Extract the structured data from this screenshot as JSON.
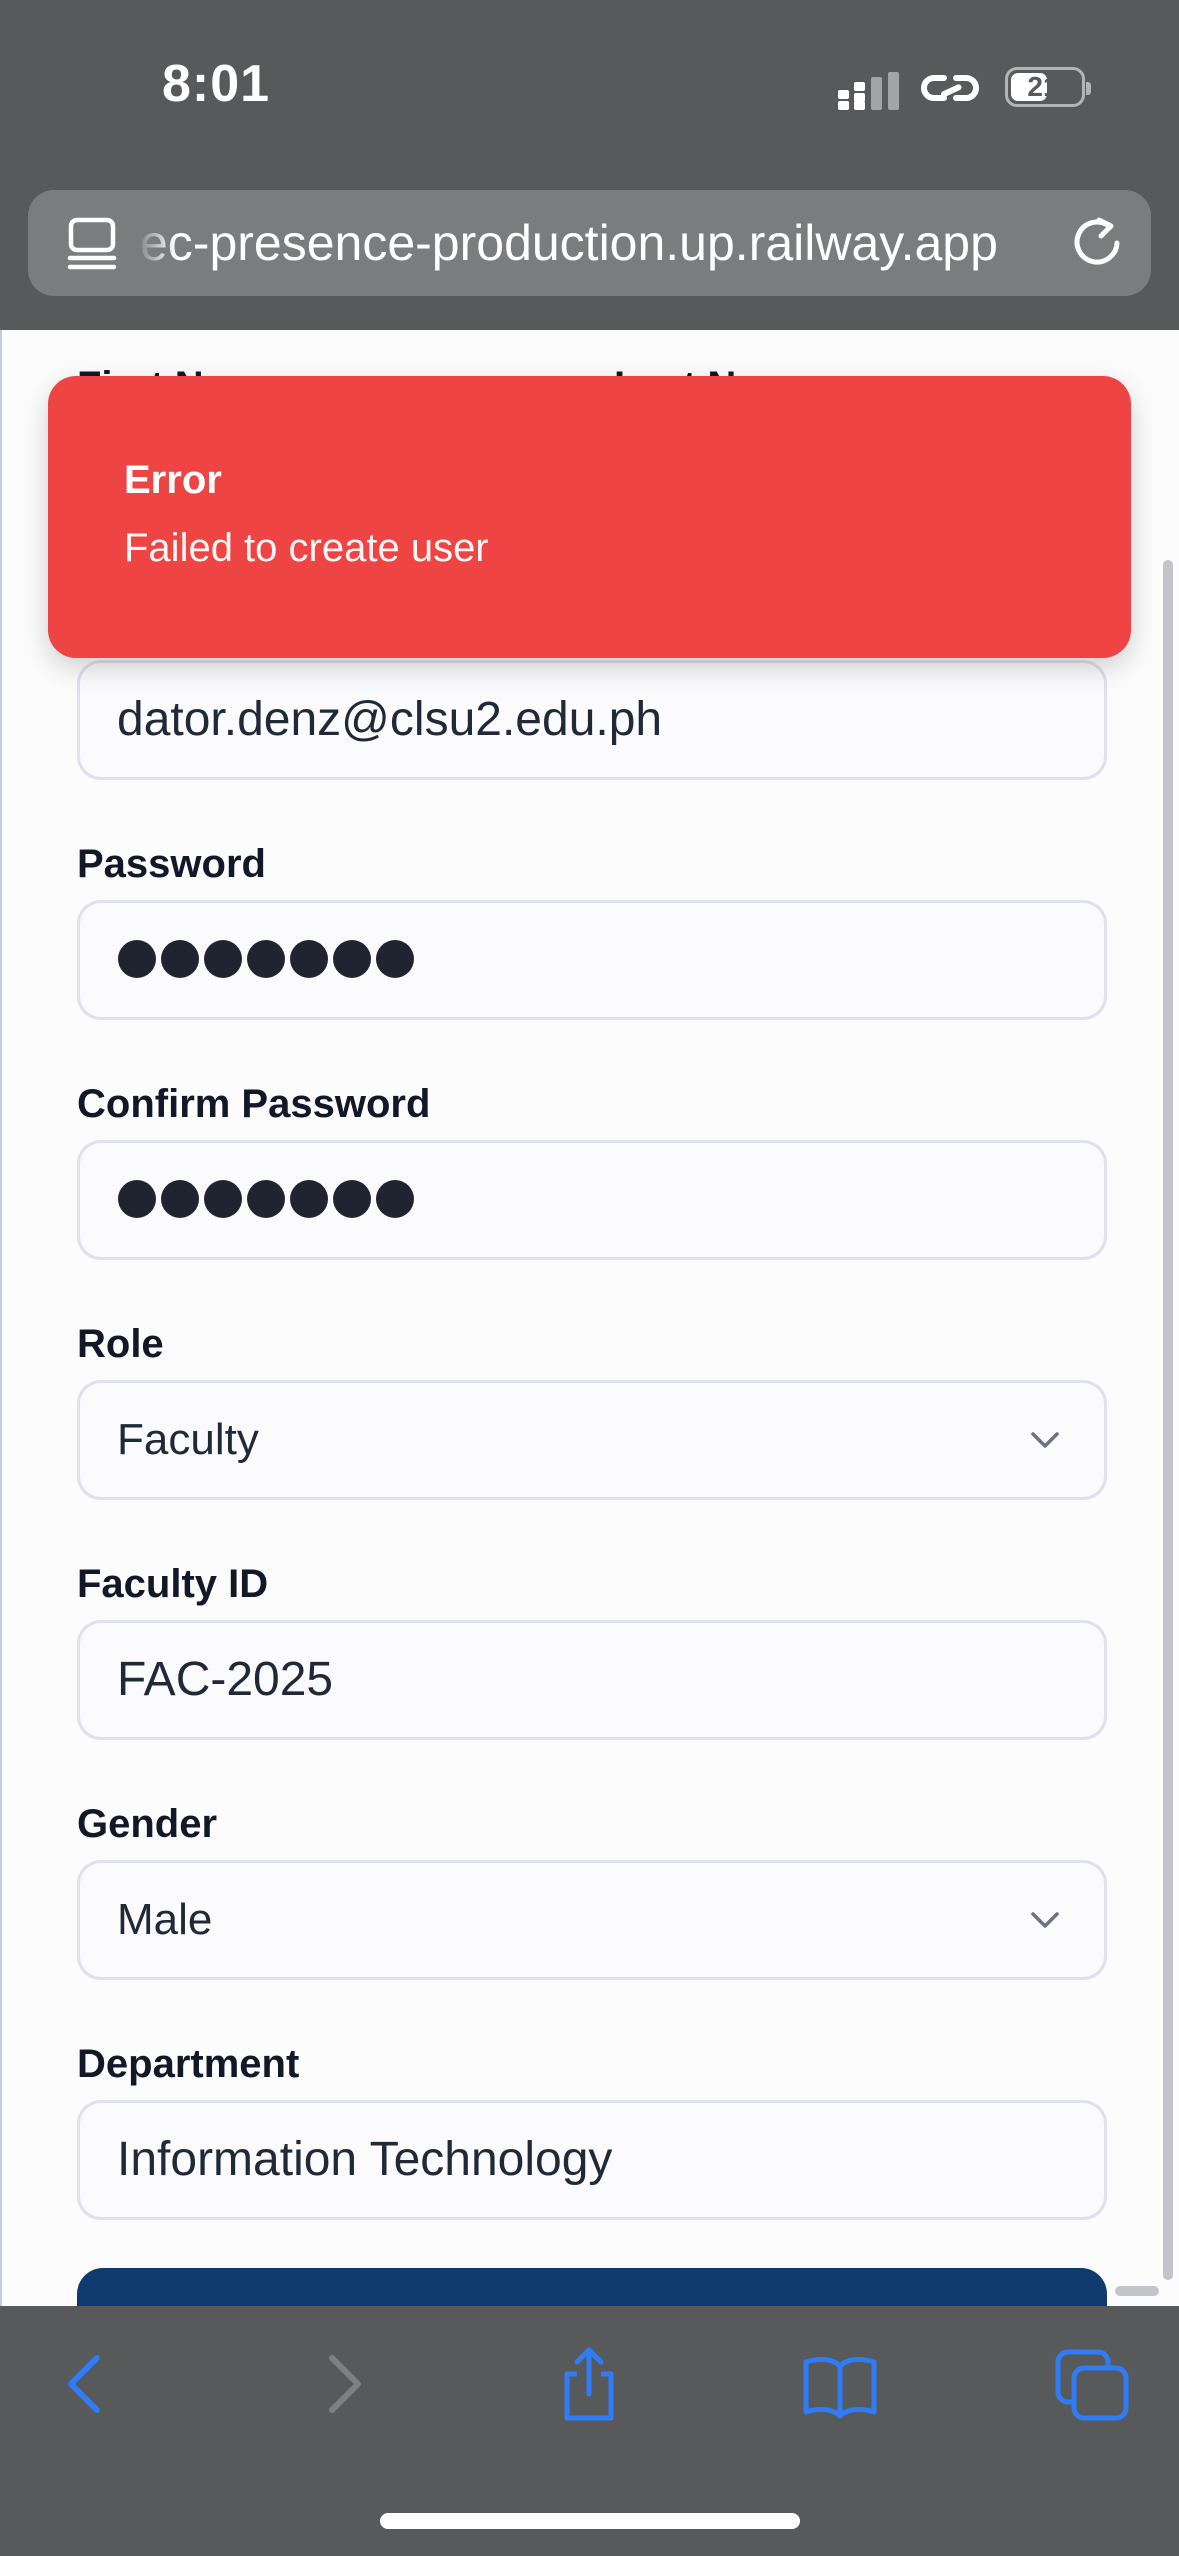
{
  "status_bar": {
    "time": "8:01",
    "battery": "21"
  },
  "browser": {
    "url": "ec-presence-production.up.railway.app"
  },
  "form": {
    "first_name_label": "First Name",
    "last_name_label": "Last Name",
    "email_value": "dator.denz@clsu2.edu.ph",
    "password_label": "Password",
    "confirm_password_label": "Confirm Password",
    "role_label": "Role",
    "role_value": "Faculty",
    "faculty_id_label": "Faculty ID",
    "faculty_id_value": "FAC-2025",
    "gender_label": "Gender",
    "gender_value": "Male",
    "department_label": "Department",
    "department_value": "Information Technology"
  },
  "toast": {
    "title": "Error",
    "message": "Failed to create user",
    "color": "#ef4444"
  },
  "colors": {
    "chrome": "#58595b",
    "accent": "#2f7cf6",
    "submit": "#0f3a6e"
  },
  "toolbar": {
    "icons": [
      "back-icon",
      "forward-icon",
      "share-icon",
      "bookmarks-icon",
      "tabs-icon"
    ]
  }
}
